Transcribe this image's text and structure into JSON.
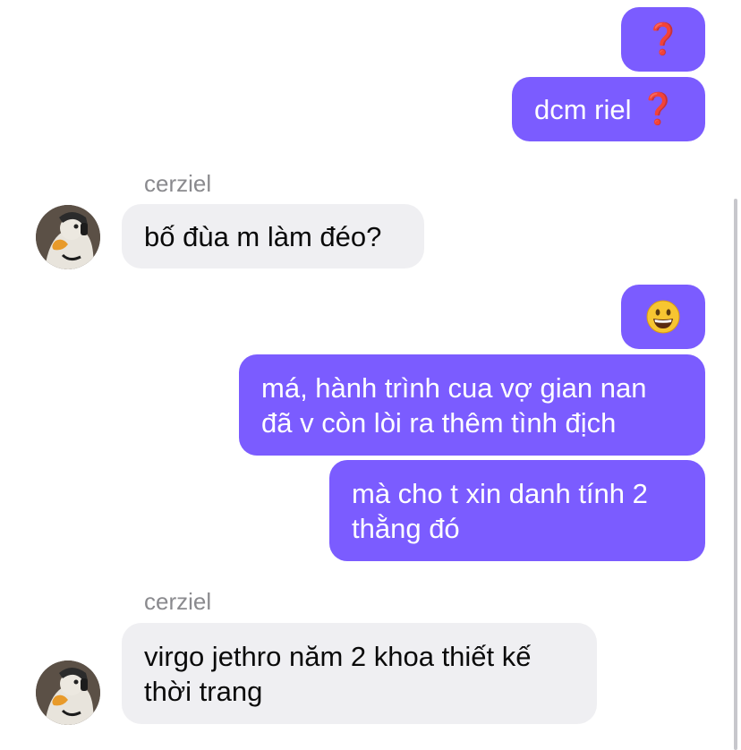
{
  "messages": [
    {
      "type": "sent",
      "text": "",
      "trailing": "❓"
    },
    {
      "type": "sent",
      "text": "dcm riel ",
      "trailing": "❓"
    },
    {
      "type": "sender",
      "name": "cerziel"
    },
    {
      "type": "recv",
      "text": "bố đùa m làm đéo?"
    },
    {
      "type": "sent",
      "emoji": "grinning-face"
    },
    {
      "type": "sent",
      "text": "má, hành trình cua vợ gian nan\nđã v còn lòi ra thêm tình địch"
    },
    {
      "type": "sent",
      "text": "mà cho t xin danh tính 2\nthằng đó"
    },
    {
      "type": "sender",
      "name": "cerziel"
    },
    {
      "type": "recv",
      "text": "virgo jethro năm 2 khoa thiết kế\nthời trang"
    }
  ],
  "colors": {
    "sent_bubble": "#7b5cff",
    "recv_bubble": "#efeff2",
    "sender_name": "#8a8a8e",
    "question_mark": "#e0101f"
  }
}
